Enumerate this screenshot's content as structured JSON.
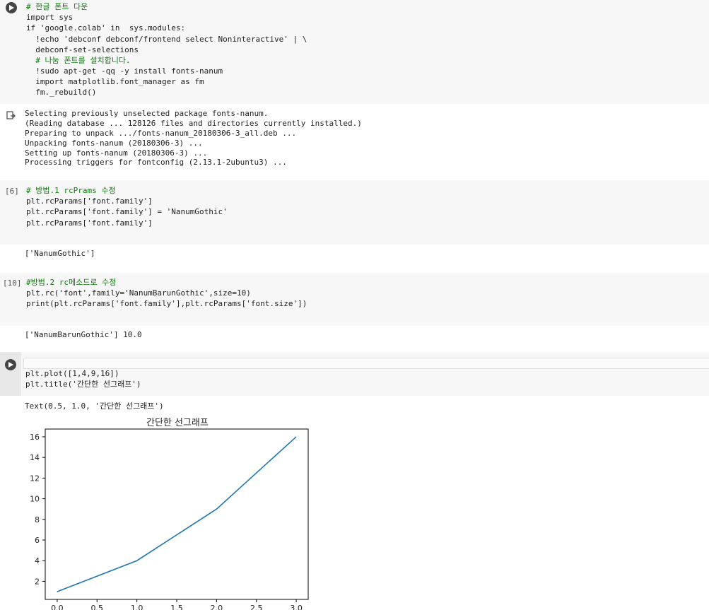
{
  "cells": [
    {
      "id": "cell-1",
      "lines": [
        "# 한글 폰트 다운",
        "import sys",
        "if 'google.colab' in  sys.modules:",
        "  !echo 'debconf debconf/frontend select Noninteractive' | \\",
        "  debconf-set-selections",
        "  # 나눔 폰트를 설치합니다.",
        "  !sudo apt-get -qq -y install fonts-nanum",
        "  import matplotlib.font_manager as fm",
        "  fm._rebuild()"
      ],
      "output": [
        "Selecting previously unselected package fonts-nanum.",
        "(Reading database ... 128126 files and directories currently installed.)",
        "Preparing to unpack .../fonts-nanum_20180306-3_all.deb ...",
        "Unpacking fonts-nanum (20180306-3) ...",
        "Setting up fonts-nanum (20180306-3) ...",
        "Processing triggers for fontconfig (2.13.1-2ubuntu3) ..."
      ]
    },
    {
      "id": "cell-2",
      "exec_count": "[6]",
      "lines": [
        "# 방법.1 rcPrams 수정",
        "plt.rcParams['font.family']",
        "plt.rcParams['font.family'] = 'NanumGothic'",
        "plt.rcParams['font.family']"
      ],
      "output": [
        "['NanumGothic']"
      ]
    },
    {
      "id": "cell-3",
      "exec_count": "[10]",
      "lines": [
        "#방법.2 rc메소드로 수정",
        "plt.rc('font',family='NanumBarunGothic',size=10)",
        "print(plt.rcParams['font.family'],plt.rcParams['font.size'])"
      ],
      "output": [
        "['NanumBarunGothic'] 10.0"
      ]
    },
    {
      "id": "cell-4",
      "lines": [
        "plt.plot([1,4,9,16])",
        "plt.title('간단한 선그래프')"
      ],
      "output": [
        "Text(0.5, 1.0, '간단한 선그래프')"
      ]
    }
  ],
  "chart_data": {
    "type": "line",
    "title": "간단한 선그래프",
    "x": [
      0,
      1,
      2,
      3
    ],
    "series": [
      {
        "values": [
          1,
          4,
          9,
          16
        ],
        "color": "#1f77b4"
      }
    ],
    "xlim": [
      -0.15,
      3.15
    ],
    "ylim": [
      0.25,
      16.75
    ],
    "x_ticks": [
      "0.0",
      "0.5",
      "1.0",
      "1.5",
      "2.0",
      "2.5",
      "3.0"
    ],
    "y_ticks": [
      "2",
      "4",
      "6",
      "8",
      "10",
      "12",
      "14",
      "16"
    ],
    "grid": false
  },
  "colors": {
    "code_bg": "#f7f7f7",
    "keyword": "#0b8a00",
    "string": "#a31515",
    "comment": "#0b7a0b"
  },
  "icons": {
    "run": "play-icon",
    "output": "output-icon"
  }
}
